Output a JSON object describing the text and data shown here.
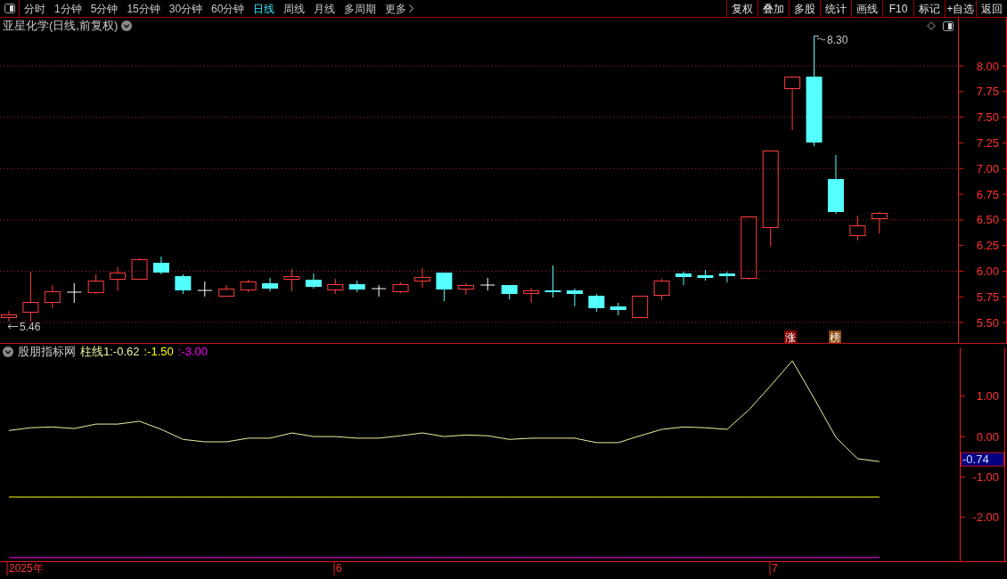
{
  "toolbar": {
    "tabs": [
      {
        "label": "分时",
        "selected": false
      },
      {
        "label": "1分钟",
        "selected": false
      },
      {
        "label": "5分钟",
        "selected": false
      },
      {
        "label": "15分钟",
        "selected": false
      },
      {
        "label": "30分钟",
        "selected": false
      },
      {
        "label": "60分钟",
        "selected": false
      },
      {
        "label": "日线",
        "selected": true
      },
      {
        "label": "周线",
        "selected": false
      },
      {
        "label": "月线",
        "selected": false
      },
      {
        "label": "多周期",
        "selected": false
      }
    ],
    "more_menu": {
      "label": "更多"
    },
    "buttons": [
      "复权",
      "叠加",
      "多股",
      "统计",
      "画线",
      "F10",
      "标记",
      "+自选",
      "返回"
    ]
  },
  "price_pane": {
    "title": "亚星化学(日线,前复权)",
    "axis_labels": [
      "8.00",
      "7.75",
      "7.50",
      "7.25",
      "7.00",
      "6.75",
      "6.50",
      "6.25",
      "6.00",
      "5.75",
      "5.50"
    ],
    "high_label": "8.30",
    "low_label": "5.46",
    "markers": [
      {
        "text": "涨",
        "color": "#800000"
      },
      {
        "text": "榜",
        "color": "#8b4a10"
      }
    ]
  },
  "indicator_pane": {
    "name": "股朋指标网",
    "readings": [
      ":-0.62",
      ":-1.50",
      ":-3.00"
    ],
    "current_value": "-0.74",
    "chart_data": {
      "type": "line",
      "categories": [
        null,
        null,
        null,
        null,
        null,
        null,
        null,
        null,
        null,
        null,
        null,
        null,
        null,
        null,
        null,
        null,
        null,
        null,
        null,
        null,
        null,
        null,
        null,
        null,
        null,
        null,
        null,
        null,
        null,
        null,
        null,
        null,
        null,
        null,
        null,
        null,
        null,
        null,
        null,
        null,
        null
      ],
      "ylim": [
        -3.09,
        2.3
      ],
      "yticks": [
        {
          "value": 1,
          "label": "1.00"
        },
        {
          "value": 0,
          "label": "0.00"
        },
        {
          "value": -1,
          "label": "-1.00"
        },
        {
          "value": -2,
          "label": "-2.00"
        }
      ],
      "series": [
        {
          "name": "柱线1",
          "color": "#f0f0a0",
          "values": [
            0.15,
            0.22,
            0.24,
            0.2,
            0.31,
            0.31,
            0.38,
            0.18,
            -0.07,
            -0.13,
            -0.13,
            -0.04,
            -0.04,
            0.09,
            0,
            0,
            -0.04,
            -0.04,
            0.02,
            0.09,
            0,
            0.04,
            0.02,
            -0.07,
            -0.04,
            -0.04,
            -0.04,
            -0.15,
            -0.15,
            0.02,
            0.18,
            0.24,
            0.22,
            0.18,
            0.66,
            1.26,
            1.88,
            0.95,
            -0.02,
            -0.55,
            -0.62
          ]
        },
        {
          "color": "#ffff00",
          "values": [
            -1.5,
            -1.5,
            -1.5,
            -1.5,
            -1.5,
            -1.5,
            -1.5,
            -1.5,
            -1.5,
            -1.5,
            -1.5,
            -1.5,
            -1.5,
            -1.5,
            -1.5,
            -1.5,
            -1.5,
            -1.5,
            -1.5,
            -1.5,
            -1.5,
            -1.5,
            -1.5,
            -1.5,
            -1.5,
            -1.5,
            -1.5,
            -1.5,
            -1.5,
            -1.5,
            -1.5,
            -1.5,
            -1.5,
            -1.5,
            -1.5,
            -1.5,
            -1.5,
            -1.5,
            -1.5,
            -1.5,
            -1.5
          ]
        },
        {
          "color": "#ff00ff",
          "values": [
            -3,
            -3,
            -3,
            -3,
            -3,
            -3,
            -3,
            -3,
            -3,
            -3,
            -3,
            -3,
            -3,
            -3,
            -3,
            -3,
            -3,
            -3,
            -3,
            -3,
            -3,
            -3,
            -3,
            -3,
            -3,
            -3,
            -3,
            -3,
            -3,
            -3,
            -3,
            -3,
            -3,
            -3,
            -3,
            -3,
            -3,
            -3,
            -3,
            -3,
            -3
          ]
        }
      ]
    }
  },
  "date_axis": {
    "labels": [
      "2025年",
      "6",
      "7"
    ]
  }
}
